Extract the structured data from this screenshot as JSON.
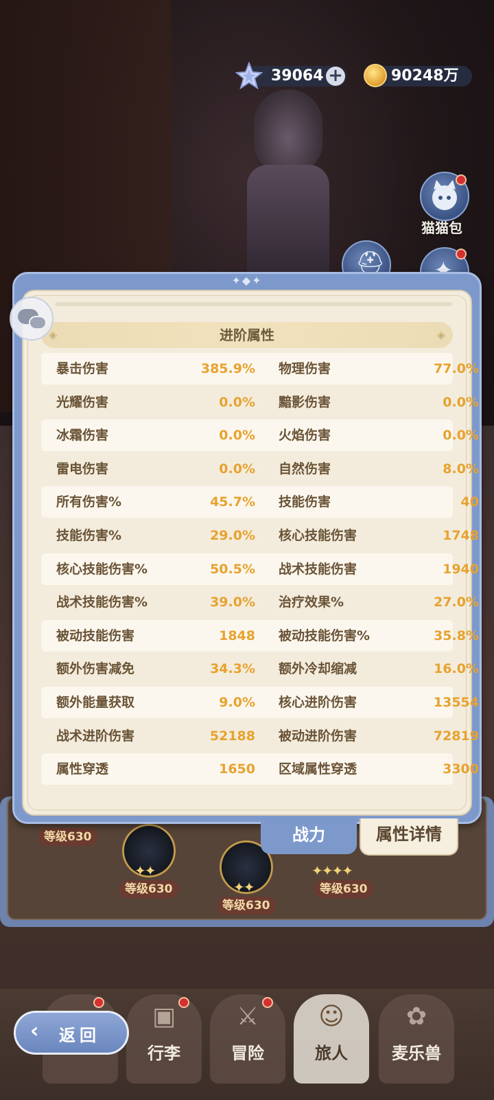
{
  "currency": {
    "gems": "39064",
    "gold": "90248万",
    "gem_icon": "crystal-star-icon",
    "gold_icon": "gold-coin-icon",
    "add_symbol": "+"
  },
  "side_buttons": [
    {
      "label": "猫猫包",
      "icon": "cat-bag-icon",
      "has_alert": true
    },
    {
      "label": "",
      "icon": "helmet-icon",
      "has_alert": false
    },
    {
      "label": "",
      "icon": "creature-icon",
      "has_alert": true
    }
  ],
  "panel": {
    "section_title": "进阶属性",
    "stats": [
      [
        {
          "name": "暴击伤害",
          "value": "385.9%"
        },
        {
          "name": "物理伤害",
          "value": "77.0%"
        }
      ],
      [
        {
          "name": "光耀伤害",
          "value": "0.0%"
        },
        {
          "name": "黯影伤害",
          "value": "0.0%"
        }
      ],
      [
        {
          "name": "冰霜伤害",
          "value": "0.0%"
        },
        {
          "name": "火焰伤害",
          "value": "0.0%"
        }
      ],
      [
        {
          "name": "雷电伤害",
          "value": "0.0%"
        },
        {
          "name": "自然伤害",
          "value": "8.0%"
        }
      ],
      [
        {
          "name": "所有伤害%",
          "value": "45.7%"
        },
        {
          "name": "技能伤害",
          "value": "40"
        }
      ],
      [
        {
          "name": "技能伤害%",
          "value": "29.0%"
        },
        {
          "name": "核心技能伤害",
          "value": "1748"
        }
      ],
      [
        {
          "name": "核心技能伤害%",
          "value": "50.5%"
        },
        {
          "name": "战术技能伤害",
          "value": "1940"
        }
      ],
      [
        {
          "name": "战术技能伤害%",
          "value": "39.0%"
        },
        {
          "name": "治疗效果%",
          "value": "27.0%"
        }
      ],
      [
        {
          "name": "被动技能伤害",
          "value": "1848"
        },
        {
          "name": "被动技能伤害%",
          "value": "35.8%"
        }
      ],
      [
        {
          "name": "额外伤害减免",
          "value": "34.3%"
        },
        {
          "name": "额外冷却缩减",
          "value": "16.0%"
        }
      ],
      [
        {
          "name": "额外能量获取",
          "value": "9.0%"
        },
        {
          "name": "核心进阶伤害",
          "value": "13554"
        }
      ],
      [
        {
          "name": "战术进阶伤害",
          "value": "52188"
        },
        {
          "name": "被动进阶伤害",
          "value": "72819"
        }
      ],
      [
        {
          "name": "属性穿透",
          "value": "1650"
        },
        {
          "name": "区域属性穿透",
          "value": "3300"
        }
      ]
    ]
  },
  "tabs": {
    "power": "战力",
    "details": "属性详情"
  },
  "skills": {
    "levels": [
      "等级630",
      "等级630",
      "等级630",
      "等级630"
    ]
  },
  "nav": {
    "back": "返回",
    "items": [
      {
        "label": "",
        "icon": "crown-icon",
        "has_alert": true
      },
      {
        "label": "行李",
        "icon": "luggage-icon",
        "has_alert": true
      },
      {
        "label": "冒险",
        "icon": "crossed-swords-icon",
        "has_alert": true
      },
      {
        "label": "旅人",
        "icon": "traveler-icon",
        "has_alert": false,
        "active": true
      },
      {
        "label": "麦乐兽",
        "icon": "fox-icon",
        "has_alert": false
      }
    ]
  },
  "colors": {
    "panel_frame": "#7d99cc",
    "panel_bg": "#f3ecdd",
    "stat_name": "#6a5336",
    "stat_value": "#e7a22e"
  }
}
